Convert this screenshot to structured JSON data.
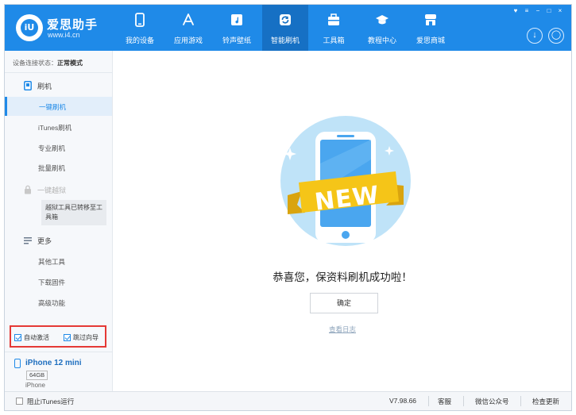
{
  "brand": {
    "name": "爱思助手",
    "url": "www.i4.cn",
    "logo_mark": "iU"
  },
  "nav": [
    {
      "label": "我的设备",
      "icon": "phone-icon"
    },
    {
      "label": "应用游戏",
      "icon": "app-store-icon"
    },
    {
      "label": "铃声壁纸",
      "icon": "music-icon"
    },
    {
      "label": "智能刷机",
      "icon": "refresh-icon",
      "active": true
    },
    {
      "label": "工具箱",
      "icon": "toolbox-icon"
    },
    {
      "label": "教程中心",
      "icon": "graduation-cap-icon"
    },
    {
      "label": "爱思商城",
      "icon": "store-icon"
    }
  ],
  "window_controls": [
    "♥",
    "≡",
    "−",
    "□",
    "×"
  ],
  "header_buttons": {
    "download": "↓",
    "user": "◯"
  },
  "sidebar": {
    "status_label": "设备连接状态：",
    "status_value": "正常模式",
    "flash_group": "刷机",
    "flash_items": [
      "一键刷机",
      "iTunes刷机",
      "专业刷机",
      "批量刷机"
    ],
    "jailbreak_group": "一键越狱",
    "jailbreak_notice": "越狱工具已转移至工具箱",
    "more_group": "更多",
    "more_items": [
      "其他工具",
      "下载固件",
      "高级功能"
    ],
    "auto_activate": "自动激活",
    "skip_guide": "跳过向导"
  },
  "device": {
    "name": "iPhone 12 mini",
    "storage": "64GB",
    "type": "iPhone"
  },
  "main": {
    "badge_text": "NEW",
    "success_message": "恭喜您，保资料刷机成功啦！",
    "confirm_button": "确定",
    "view_log": "查看日志"
  },
  "footer": {
    "stop_itunes": "阻止iTunes运行",
    "version": "V7.98.66",
    "service": "客服",
    "wechat": "微信公众号",
    "check_update": "检查更新"
  },
  "colors": {
    "accent": "#1f8ae8",
    "ribbon": "#f5c518",
    "highlight_border": "#e53935"
  }
}
